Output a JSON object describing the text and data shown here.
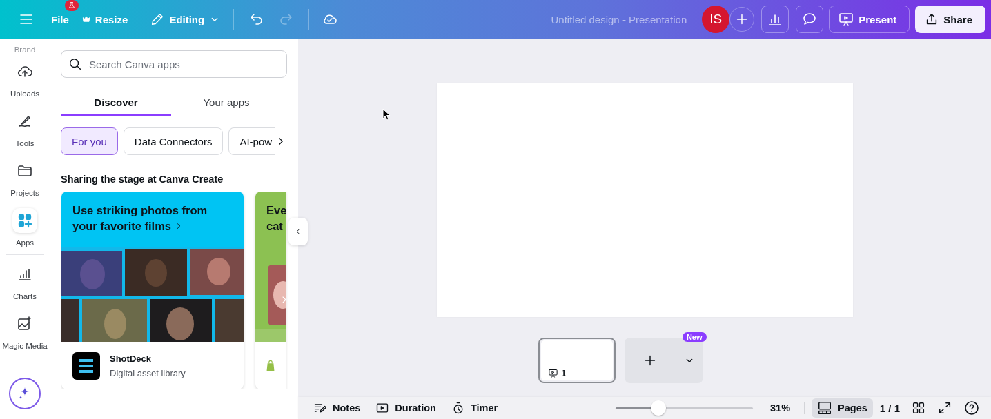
{
  "topbar": {
    "menus": [
      {
        "kind": "file",
        "label": "File"
      },
      {
        "kind": "resize",
        "label": "Resize"
      },
      {
        "kind": "editing",
        "label": "Editing"
      }
    ],
    "history": [
      {
        "kind": "undo",
        "disabled": false
      },
      {
        "kind": "redo",
        "disabled": true
      }
    ],
    "title": "Untitled design - Presentation",
    "avatar": "IS",
    "actions": [
      {
        "kind": "present",
        "label": "Present"
      },
      {
        "kind": "share",
        "label": "Share"
      }
    ]
  },
  "rail": {
    "items": [
      {
        "kind": "brand",
        "label": "Brand",
        "selected": false
      },
      {
        "kind": "uploads",
        "label": "Uploads",
        "selected": false
      },
      {
        "kind": "tools",
        "label": "Tools",
        "selected": false
      },
      {
        "kind": "projects",
        "label": "Projects",
        "selected": false
      },
      {
        "kind": "apps",
        "label": "Apps",
        "selected": true
      },
      {
        "kind": "charts",
        "label": "Charts",
        "selected": false
      },
      {
        "kind": "magic",
        "label": "Magic Media",
        "selected": false
      }
    ]
  },
  "panel": {
    "search": {
      "placeholder": "Search Canva apps"
    },
    "tabs": [
      {
        "label": "Discover",
        "selected": true
      },
      {
        "label": "Your apps",
        "selected": false
      }
    ],
    "chips": [
      {
        "label": "For you",
        "selected": true
      },
      {
        "label": "Data Connectors",
        "selected": false
      },
      {
        "label": "AI-pow",
        "selected": false
      }
    ],
    "section_title": "Sharing the stage at Canva Create",
    "cards": [
      {
        "headline": "Use striking photos from your favorite films",
        "color": "#00c4f3",
        "app_name": "ShotDeck",
        "app_description": "Digital asset library"
      },
      {
        "headline": "Eve cat",
        "color": "#8cc152"
      }
    ]
  },
  "pages": {
    "thumbnails": [
      {
        "number": "1",
        "selected": true
      }
    ],
    "new_badge": "New"
  },
  "bottom_bar": {
    "tools": [
      {
        "kind": "notes",
        "label": "Notes"
      },
      {
        "kind": "duration",
        "label": "Duration"
      },
      {
        "kind": "timer",
        "label": "Timer"
      }
    ],
    "zoom": {
      "level": 0.31,
      "reading": "31%"
    },
    "pages_button": {
      "label": "Pages",
      "selected": true
    },
    "page_count": "1 / 1"
  }
}
